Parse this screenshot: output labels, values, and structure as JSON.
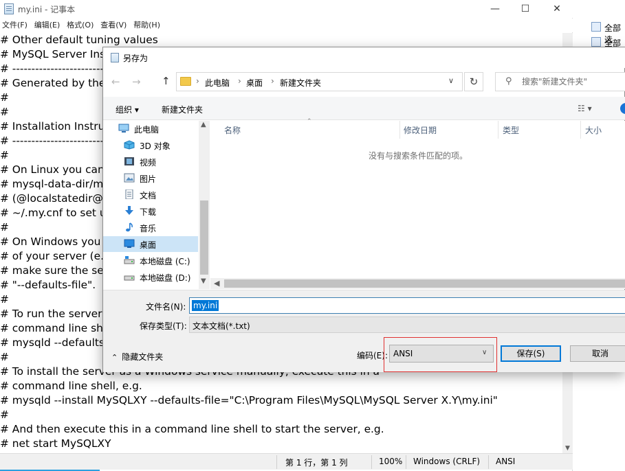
{
  "notepad": {
    "title": "my.ini - 记事本",
    "minimize": "—",
    "maximize": "☐",
    "close": "✕",
    "menu": [
      "文件(F)",
      "编辑(E)",
      "格式(O)",
      "查看(V)",
      "帮助(H)"
    ],
    "lines": [
      "# Other default tuning values",
      "# MySQL Server Inst",
      "# -------------------------------",
      "# Generated by the",
      "#",
      "#",
      "# Installation Instruc",
      "# -------------------------------",
      "#",
      "# On Linux you can",
      "# mysql-data-dir/my",
      "# (@localstatedir@",
      "# ~/.my.cnf to set u",
      "#",
      "# On Windows you",
      "# of your server (e.g",
      "# make sure the ser",
      "# \"--defaults-file\".",
      "#",
      "# To run the server",
      "# command line she",
      "# mysqld --defaults-",
      "#",
      "# To install the server as a Windows service manually, execute this in a",
      "# command line shell, e.g.",
      "# mysqld --install MySQLXY --defaults-file=\"C:\\Program Files\\MySQL\\MySQL Server X.Y\\my.ini\"",
      "#",
      "# And then execute this in a command line shell to start the server, e.g.",
      "# net start MySQLXY"
    ],
    "status": {
      "position": "第 1 行，第 1 列",
      "zoom": "100%",
      "line_ending": "Windows (CRLF)",
      "encoding": "ANSI"
    }
  },
  "background_app": {
    "items": [
      "全部选",
      "全部取"
    ]
  },
  "dialog": {
    "title": "另存为",
    "breadcrumb": [
      "此电脑",
      "桌面",
      "新建文件夹"
    ],
    "search_placeholder": "搜索\"新建文件夹\"",
    "commands": {
      "organize": "组织 ▾",
      "new_folder": "新建文件夹"
    },
    "tree": [
      {
        "label": "此电脑",
        "icon": "pc-icon",
        "indent": false
      },
      {
        "label": "3D 对象",
        "icon": "cube-icon",
        "indent": true
      },
      {
        "label": "视频",
        "icon": "video-icon",
        "indent": true
      },
      {
        "label": "图片",
        "icon": "picture-icon",
        "indent": true
      },
      {
        "label": "文档",
        "icon": "document-icon",
        "indent": true
      },
      {
        "label": "下载",
        "icon": "download-icon",
        "indent": true
      },
      {
        "label": "音乐",
        "icon": "music-icon",
        "indent": true
      },
      {
        "label": "桌面",
        "icon": "desktop-icon",
        "indent": true,
        "selected": true
      },
      {
        "label": "本地磁盘 (C:)",
        "icon": "drive-c-icon",
        "indent": true
      },
      {
        "label": "本地磁盘 (D:)",
        "icon": "drive-d-icon",
        "indent": true
      }
    ],
    "columns": [
      "名称",
      "修改日期",
      "类型",
      "大小"
    ],
    "empty_message": "没有与搜索条件匹配的项。",
    "file_name_label": "文件名(N):",
    "file_name_value": "my.ini",
    "file_type_label": "保存类型(T):",
    "file_type_value": "文本文档(*.txt)",
    "hide_folders": "隐藏文件夹",
    "encoding_label": "编码(E):",
    "encoding_value": "ANSI",
    "save_button": "保存(S)",
    "cancel_button": "取消",
    "highlight_color": "#e03030",
    "selection_color": "#0078d7"
  }
}
